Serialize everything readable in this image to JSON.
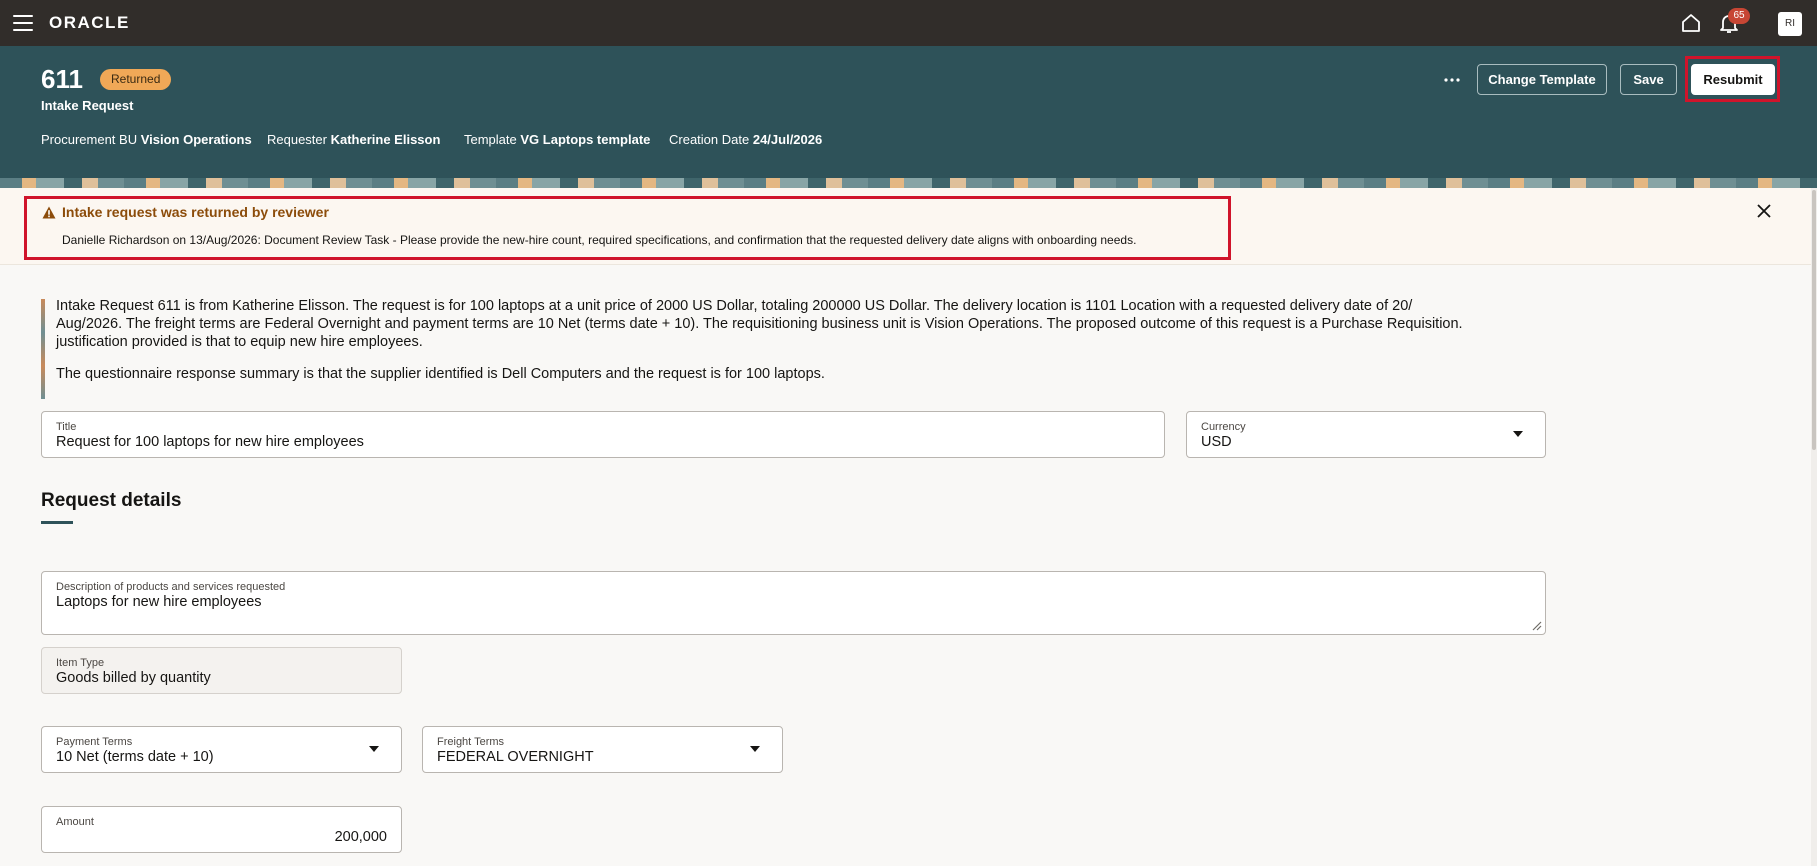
{
  "topbar": {
    "logo": "ORACLE",
    "notification_count": "65",
    "avatar_initials": "RI"
  },
  "header": {
    "request_number": "611",
    "status": "Returned",
    "subtitle": "Intake Request",
    "meta": [
      {
        "label": "Procurement BU",
        "value": "Vision Operations"
      },
      {
        "label": "Requester",
        "value": "Katherine Elisson"
      },
      {
        "label": "Template",
        "value": "VG Laptops template"
      },
      {
        "label": "Creation Date",
        "value": "24/Jul/2026"
      }
    ],
    "buttons": {
      "change_template": "Change Template",
      "save": "Save",
      "resubmit": "Resubmit"
    }
  },
  "banner": {
    "title": "Intake request was returned by reviewer",
    "message": "Danielle Richardson on 13/Aug/2026: Document Review Task - Please provide the new-hire count, required specifications, and confirmation that the requested delivery date aligns with onboarding needs."
  },
  "summary": {
    "paragraph1": "Intake Request 611 is from Katherine Elisson. The request is for 100 laptops at a unit price of 2000 US Dollar, totaling 200000 US Dollar. The delivery location is 1101 Location with a requested delivery date of 20/ Aug/2026. The freight terms are Federal Overnight and payment terms are 10 Net (terms date + 10). The requisitioning business unit is Vision Operations. The proposed outcome of this request is a Purchase Requisition. justification provided is that to equip new hire employees.",
    "paragraph2": "The questionnaire response summary is that the supplier identified is Dell Computers and the request is for 100 laptops."
  },
  "form": {
    "title": {
      "label": "Title",
      "value": "Request for 100 laptops for new hire employees"
    },
    "currency": {
      "label": "Currency",
      "value": "USD"
    },
    "section_title": "Request details",
    "description": {
      "label": "Description of products and services requested",
      "value": "Laptops for new hire employees"
    },
    "item_type": {
      "label": "Item Type",
      "value": "Goods billed by quantity"
    },
    "payment_terms": {
      "label": "Payment Terms",
      "value": "10 Net (terms date + 10)"
    },
    "freight_terms": {
      "label": "Freight Terms",
      "value": "FEDERAL OVERNIGHT"
    },
    "amount": {
      "label": "Amount",
      "value": "200,000"
    }
  },
  "colors": {
    "topbar": "#312d2a",
    "header": "#2e5259",
    "status_pill": "#f0a857",
    "highlight": "#d0142b",
    "warning_text": "#8c4c0a"
  }
}
